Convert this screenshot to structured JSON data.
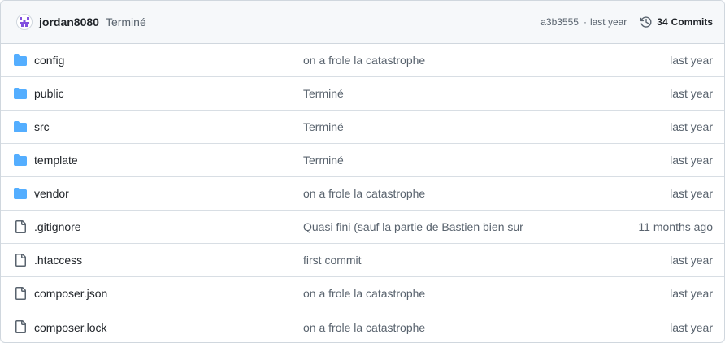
{
  "header": {
    "author": "jordan8080",
    "commit_message": "Terminé",
    "commit_hash": "a3b3555",
    "separator": "·",
    "commit_time": "last year",
    "commit_count": "34",
    "commits_label": "Commits"
  },
  "colors": {
    "folder_icon": "#54aeff",
    "file_icon": "#59636e",
    "avatar": "#8250df"
  },
  "files": [
    {
      "type": "folder",
      "icon": "folder-icon",
      "name": "config",
      "message": "on a frole la catastrophe",
      "age": "last year"
    },
    {
      "type": "folder",
      "icon": "folder-icon",
      "name": "public",
      "message": "Terminé",
      "age": "last year"
    },
    {
      "type": "folder",
      "icon": "folder-icon",
      "name": "src",
      "message": "Terminé",
      "age": "last year"
    },
    {
      "type": "folder",
      "icon": "folder-icon",
      "name": "template",
      "message": "Terminé",
      "age": "last year"
    },
    {
      "type": "folder",
      "icon": "folder-icon",
      "name": "vendor",
      "message": "on a frole la catastrophe",
      "age": "last year"
    },
    {
      "type": "file",
      "icon": "file-icon",
      "name": ".gitignore",
      "message": "Quasi fini (sauf la partie de Bastien bien sur",
      "age": "11 months ago"
    },
    {
      "type": "file",
      "icon": "file-icon",
      "name": ".htaccess",
      "message": "first commit",
      "age": "last year"
    },
    {
      "type": "file",
      "icon": "file-icon",
      "name": "composer.json",
      "message": "on a frole la catastrophe",
      "age": "last year"
    },
    {
      "type": "file",
      "icon": "file-icon",
      "name": "composer.lock",
      "message": "on a frole la catastrophe",
      "age": "last year"
    }
  ]
}
